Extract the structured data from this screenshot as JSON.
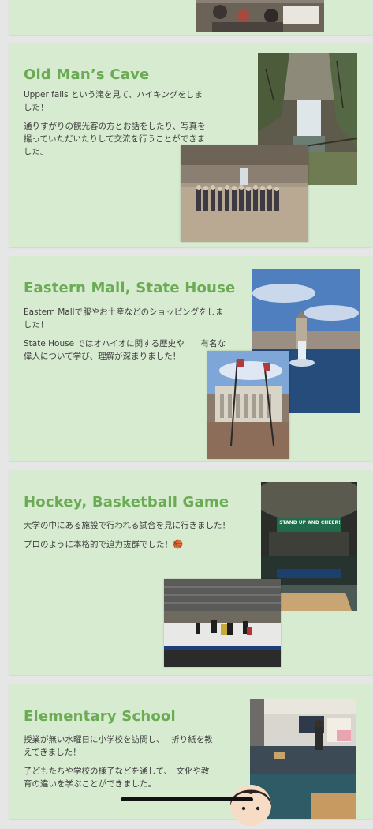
{
  "sections": [
    {
      "title": "Old Man’s Cave",
      "paragraphs": [
        "Upper falls という滝を見て、ハイキングをしました！",
        "通りすがりの観光客の方とお話をしたり、写真を撮っていただいたりして交流を行うことができました。"
      ]
    },
    {
      "title": "Eastern Mall, State House",
      "paragraphs": [
        "Eastern Mallで服やお土産などのショッピングをしました！",
        "State House ではオハイオに関する歴史や　　有名な偉人について学び、理解が深まりました！"
      ]
    },
    {
      "title": "Hockey, Basketball Game",
      "paragraphs": [
        "大学の中にある施設で行われる試合を見に行きました！",
        "プロのように本格的で迫力抜群でした！🏀"
      ],
      "arena_banner": "STAND UP AND CHEER!"
    },
    {
      "title": "Elementary School",
      "paragraphs": [
        "授業が無い水曜日に小学校を訪問し、　 折り紙を教えてきました！",
        "子どもたちや学校の様子などを通して、　文化や教育の違いを学ぶことができました。"
      ]
    }
  ],
  "colors": {
    "card_background": "#d7ebd0",
    "title_green": "#6aab54",
    "page_background": "#e6e6e6"
  }
}
